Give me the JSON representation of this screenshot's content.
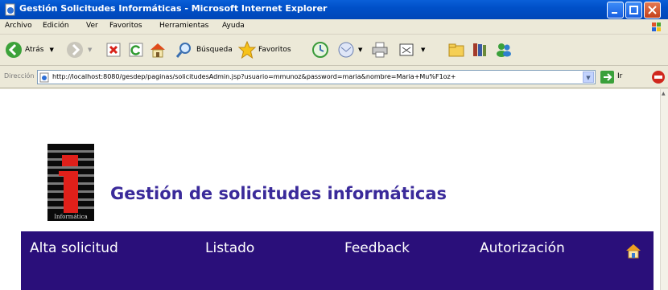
{
  "window": {
    "title": "Gestión Solicitudes Informáticas - Microsoft Internet Explorer"
  },
  "menubar": {
    "items": [
      "Archivo",
      "Edición",
      "Ver",
      "Favoritos",
      "Herramientas",
      "Ayuda"
    ]
  },
  "toolbar": {
    "back_label": "Atrás",
    "search_label": "Búsqueda",
    "favorites_label": "Favoritos",
    "go_label": "Ir"
  },
  "address": {
    "label": "Dirección",
    "url": "http://localhost:8080/gesdep/paginas/solicitudesAdmin.jsp?usuario=mmunoz&password=maria&nombre=Maria+Mu%F1oz+"
  },
  "page": {
    "logo_caption": "Informática",
    "title": "Gestión de solicitudes informáticas",
    "nav": [
      "Alta solicitud",
      "Listado",
      "Feedback",
      "Autorización"
    ]
  }
}
